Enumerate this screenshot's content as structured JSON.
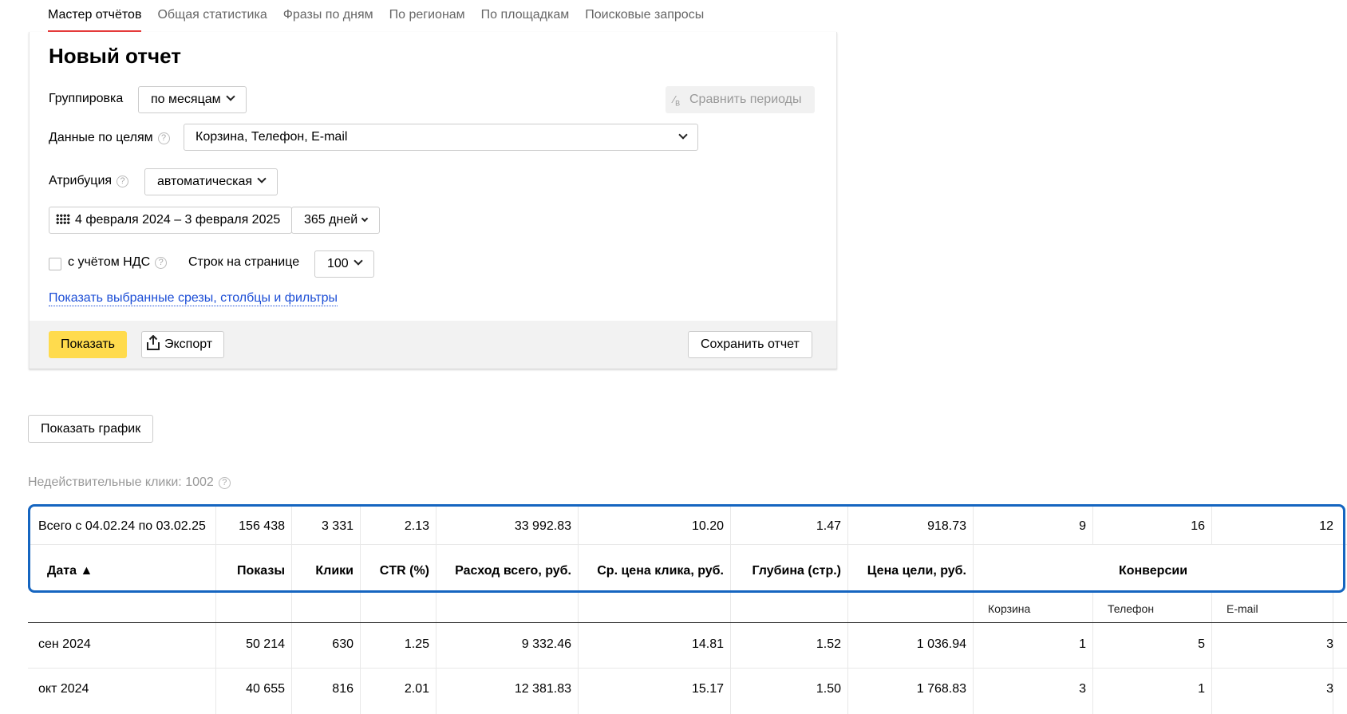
{
  "tabs": [
    "Мастер отчётов",
    "Общая статистика",
    "Фразы по дням",
    "По регионам",
    "По площадкам",
    "Поисковые запросы"
  ],
  "panel": {
    "title": "Новый отчет",
    "grouping_label": "Группировка",
    "grouping_value": "по месяцам",
    "compare_label": "Сравнить периоды",
    "goals_label": "Данные по целям",
    "goals_value": "Корзина, Телефон, E-mail",
    "attribution_label": "Атрибуция",
    "attribution_value": "автоматическая",
    "date_range": "4 февраля 2024 – 3 февраля 2025",
    "days_value": "365 дней",
    "vat_label": "с учётом НДС",
    "rows_label": "Строк на странице",
    "rows_value": "100",
    "show_filters_link": "Показать выбранные срезы, столбцы и фильтры",
    "show_button": "Показать",
    "export_button": "Экспорт",
    "save_button": "Сохранить отчет"
  },
  "show_chart_button": "Показать график",
  "invalid_clicks": "Недействительные клики: 1002",
  "table": {
    "totals": [
      "Всего с 04.02.24 по 03.02.25",
      "156 438",
      "3 331",
      "2.13",
      "33 992.83",
      "10.20",
      "1.47",
      "918.73",
      "9",
      "16",
      "12"
    ],
    "headers": [
      "Дата ▲",
      "Показы",
      "Клики",
      "CTR (%)",
      "Расход всего, руб.",
      "Ср. цена клика, руб.",
      "Глубина (стр.)",
      "Цена цели, руб.",
      "Конверсии"
    ],
    "conversion_subheaders": [
      "Корзина",
      "Телефон",
      "E-mail"
    ],
    "rows": [
      [
        "сен 2024",
        "50 214",
        "630",
        "1.25",
        "9 332.46",
        "14.81",
        "1.52",
        "1 036.94",
        "1",
        "5",
        "3"
      ],
      [
        "окт 2024",
        "40 655",
        "816",
        "2.01",
        "12 381.83",
        "15.17",
        "1.50",
        "1 768.83",
        "3",
        "1",
        "3"
      ]
    ]
  }
}
